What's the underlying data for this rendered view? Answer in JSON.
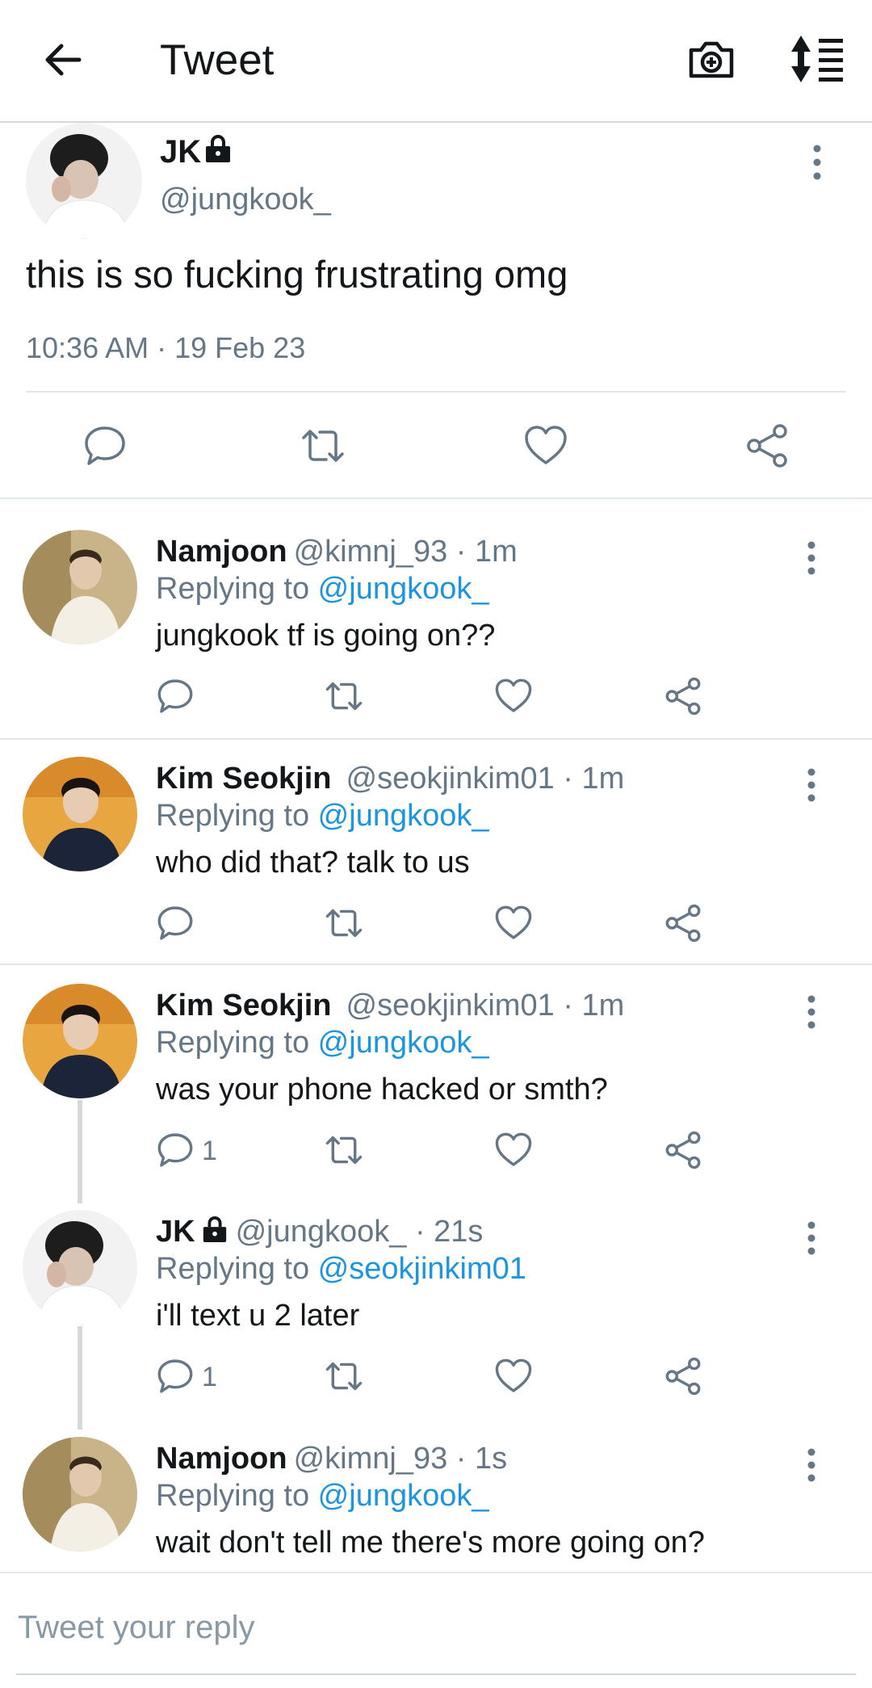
{
  "header": {
    "title": "Tweet",
    "back_icon": "arrow-left-icon",
    "camera_icon": "camera-plus-icon",
    "sort_icon": "sort-list-icon"
  },
  "main_tweet": {
    "name": "JK",
    "handle": "@jungkook_",
    "text": "this is so fucking frustrating omg",
    "timestamp": "10:36 AM · 19 Feb 23",
    "protected": true
  },
  "replies": [
    {
      "name": "Namjoon",
      "handle": "@kimnj_93 · 1m",
      "replying_prefix": "Replying to ",
      "replying_to": "@jungkook_",
      "text": "jungkook tf is going on??",
      "reply_count": ""
    },
    {
      "name": "Kim Seokjin",
      "handle": "@seokjinkim01 · 1m",
      "replying_prefix": "Replying to ",
      "replying_to": "@jungkook_",
      "text": "who did that? talk to us",
      "reply_count": ""
    },
    {
      "name": "Kim Seokjin",
      "handle": "@seokjinkim01 · 1m",
      "replying_prefix": "Replying to ",
      "replying_to": "@jungkook_",
      "text": "was your phone hacked or smth?",
      "reply_count": "1"
    },
    {
      "name": "JK",
      "handle": "@jungkook_ · 21s",
      "replying_prefix": "Replying to ",
      "replying_to": "@seokjinkim01",
      "text": "i'll text u 2 later",
      "reply_count": "1",
      "protected": true
    },
    {
      "name": "Namjoon",
      "handle": "@kimnj_93 · 1s",
      "replying_prefix": "Replying to ",
      "replying_to": "@jungkook_",
      "text": "wait don't tell me there's more going on?"
    }
  ],
  "composer": {
    "placeholder": "Tweet your reply"
  },
  "colors": {
    "link": "#1b95e0",
    "secondary": "#657786",
    "divider": "#e1e6ea"
  }
}
